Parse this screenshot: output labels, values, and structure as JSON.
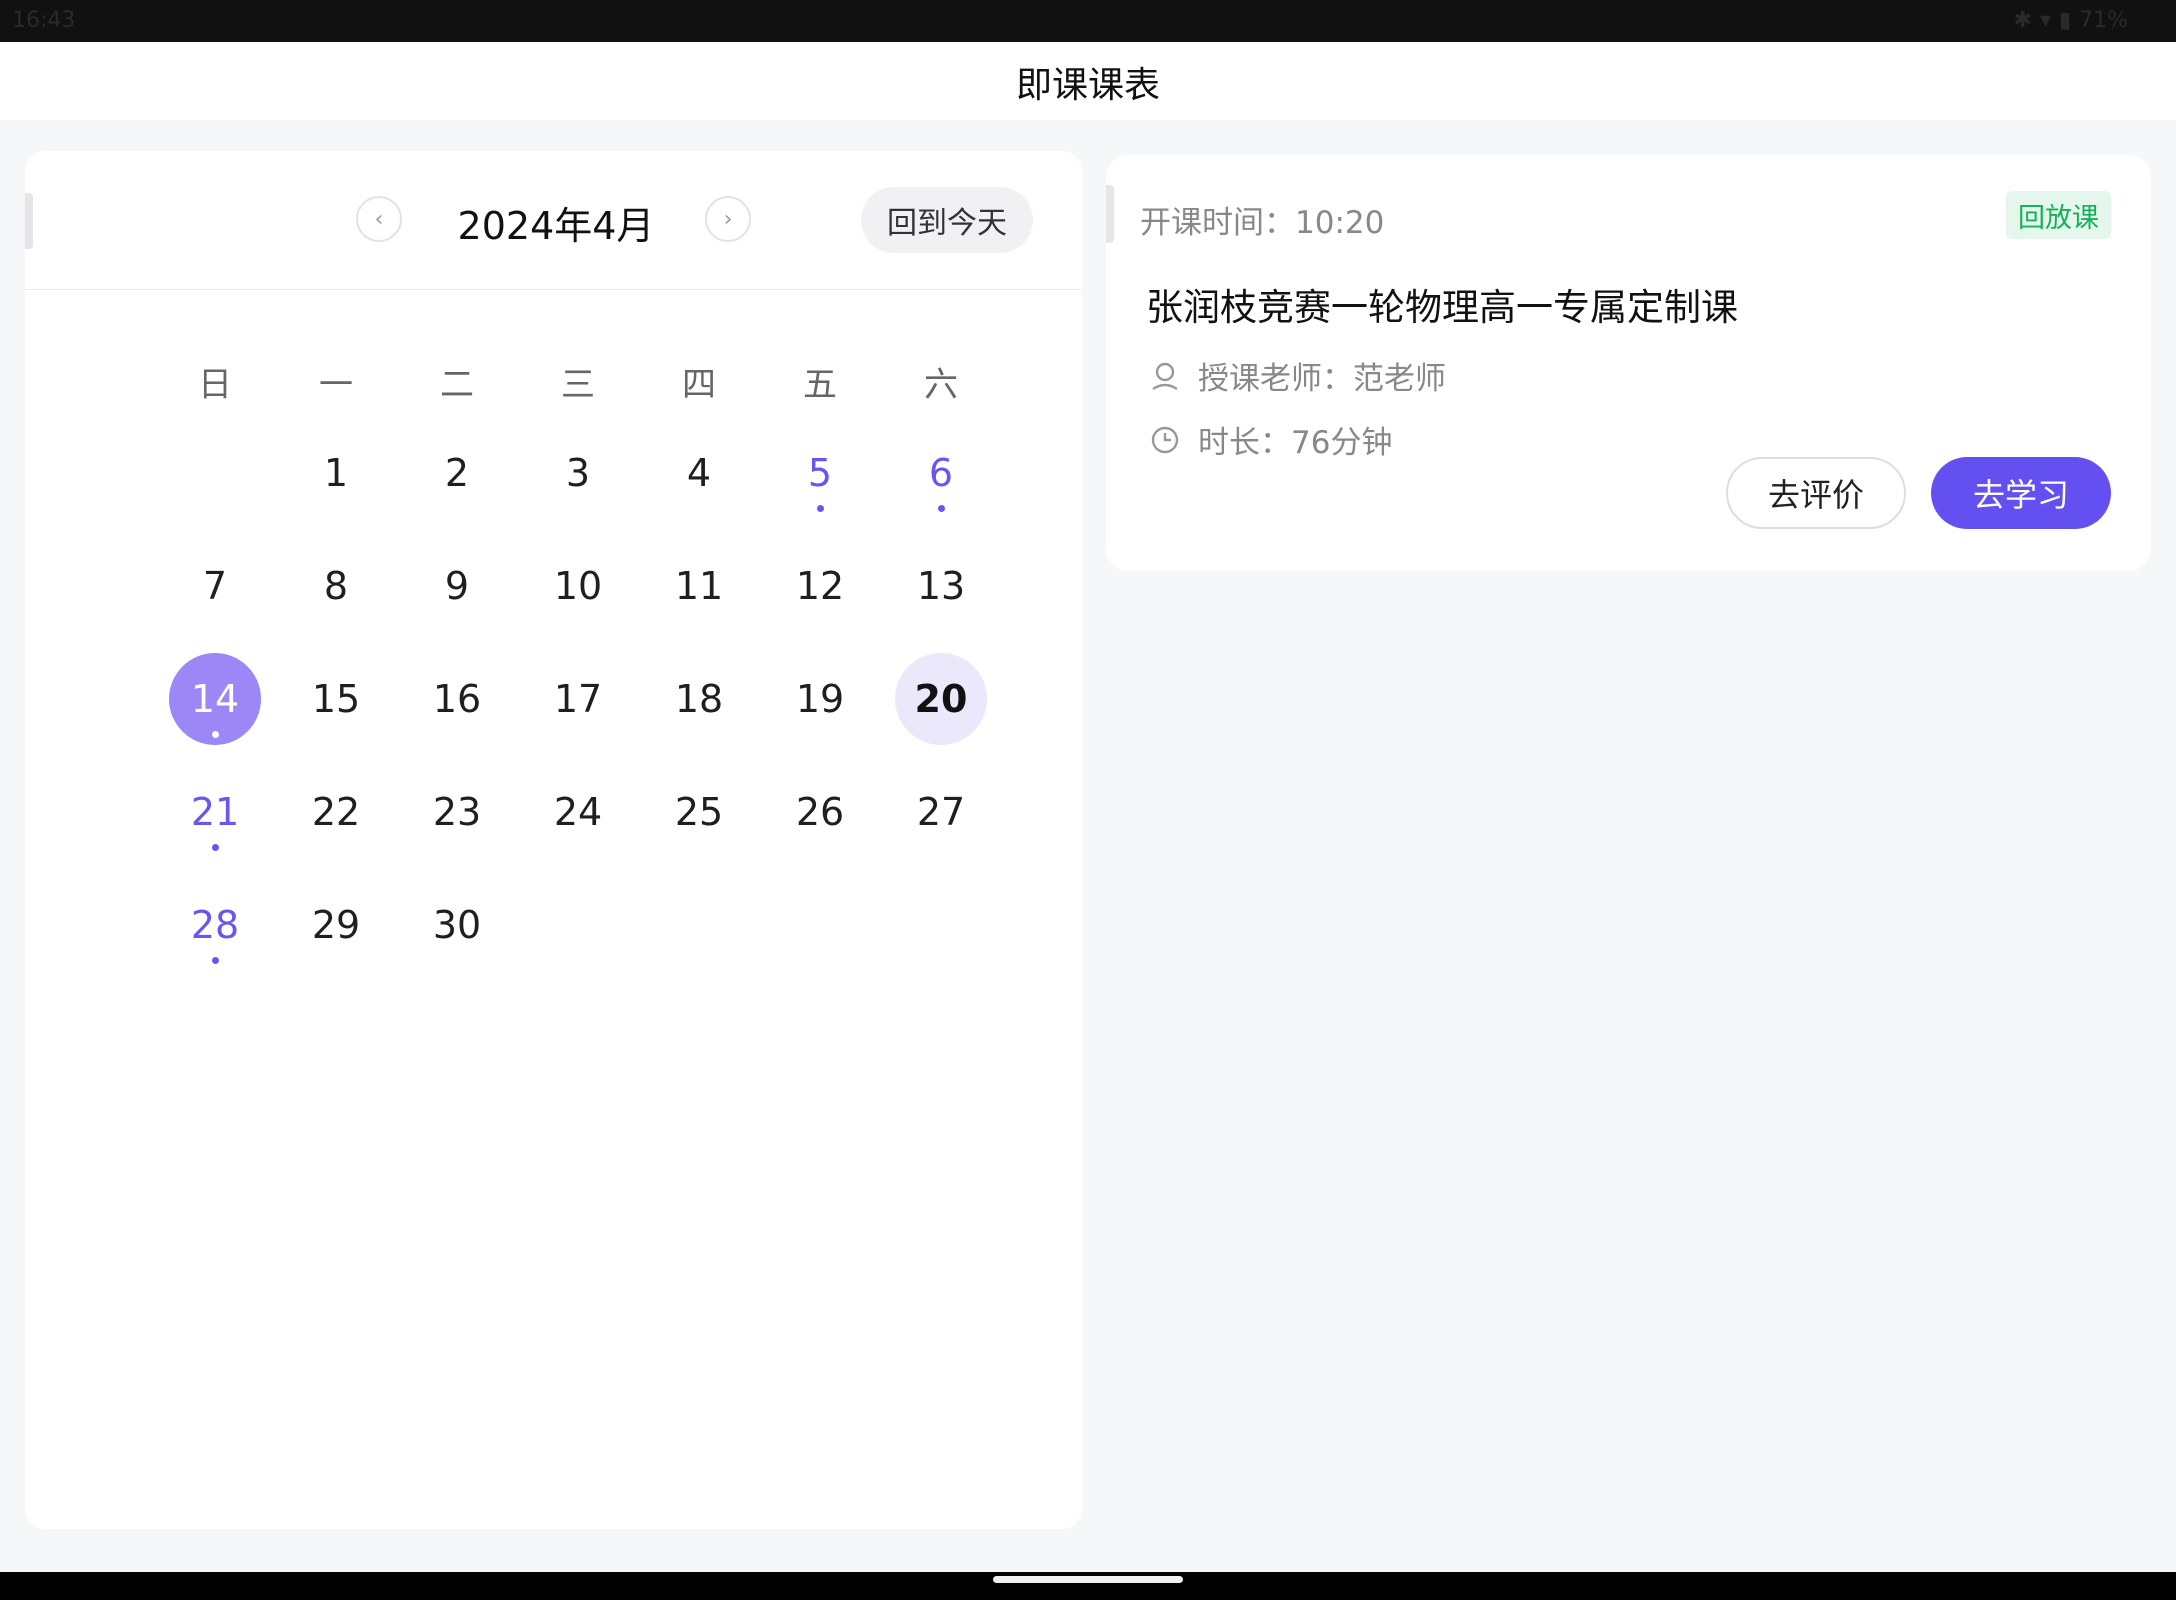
{
  "status_bar": {
    "time": "16:43",
    "battery": "71%"
  },
  "app_title": "即课课表",
  "calendar": {
    "month_label": "2024年4月",
    "today_button": "回到今天",
    "weekdays": [
      "日",
      "一",
      "二",
      "三",
      "四",
      "五",
      "六"
    ],
    "days": [
      {
        "label": "1",
        "col": 1,
        "row": 0
      },
      {
        "label": "2",
        "col": 2,
        "row": 0
      },
      {
        "label": "3",
        "col": 3,
        "row": 0
      },
      {
        "label": "4",
        "col": 4,
        "row": 0
      },
      {
        "label": "5",
        "col": 5,
        "row": 0,
        "has_course": true
      },
      {
        "label": "6",
        "col": 6,
        "row": 0,
        "has_course": true
      },
      {
        "label": "7",
        "col": 0,
        "row": 1
      },
      {
        "label": "8",
        "col": 1,
        "row": 1
      },
      {
        "label": "9",
        "col": 2,
        "row": 1
      },
      {
        "label": "10",
        "col": 3,
        "row": 1
      },
      {
        "label": "11",
        "col": 4,
        "row": 1
      },
      {
        "label": "12",
        "col": 5,
        "row": 1
      },
      {
        "label": "13",
        "col": 6,
        "row": 1
      },
      {
        "label": "14",
        "col": 0,
        "row": 2,
        "has_course": true,
        "selected": true
      },
      {
        "label": "15",
        "col": 1,
        "row": 2
      },
      {
        "label": "16",
        "col": 2,
        "row": 2
      },
      {
        "label": "17",
        "col": 3,
        "row": 2
      },
      {
        "label": "18",
        "col": 4,
        "row": 2
      },
      {
        "label": "19",
        "col": 5,
        "row": 2
      },
      {
        "label": "20",
        "col": 6,
        "row": 2,
        "today": true
      },
      {
        "label": "21",
        "col": 0,
        "row": 3,
        "has_course": true
      },
      {
        "label": "22",
        "col": 1,
        "row": 3
      },
      {
        "label": "23",
        "col": 2,
        "row": 3
      },
      {
        "label": "24",
        "col": 3,
        "row": 3
      },
      {
        "label": "25",
        "col": 4,
        "row": 3
      },
      {
        "label": "26",
        "col": 5,
        "row": 3
      },
      {
        "label": "27",
        "col": 6,
        "row": 3
      },
      {
        "label": "28",
        "col": 0,
        "row": 4,
        "has_course": true
      },
      {
        "label": "29",
        "col": 1,
        "row": 4
      },
      {
        "label": "30",
        "col": 2,
        "row": 4
      }
    ]
  },
  "course": {
    "start_time": "开课时间：10:20",
    "tag": "回放课",
    "title": "张润枝竞赛一轮物理高一专属定制课",
    "teacher": "授课老师：范老师",
    "duration": "时长：76分钟",
    "review_button": "去评价",
    "study_button": "去学习"
  },
  "colors": {
    "accent": "#6450f0",
    "selected_day": "#9b87f5",
    "today_day": "#ebe8fb",
    "tag_green": "#16b05a"
  }
}
